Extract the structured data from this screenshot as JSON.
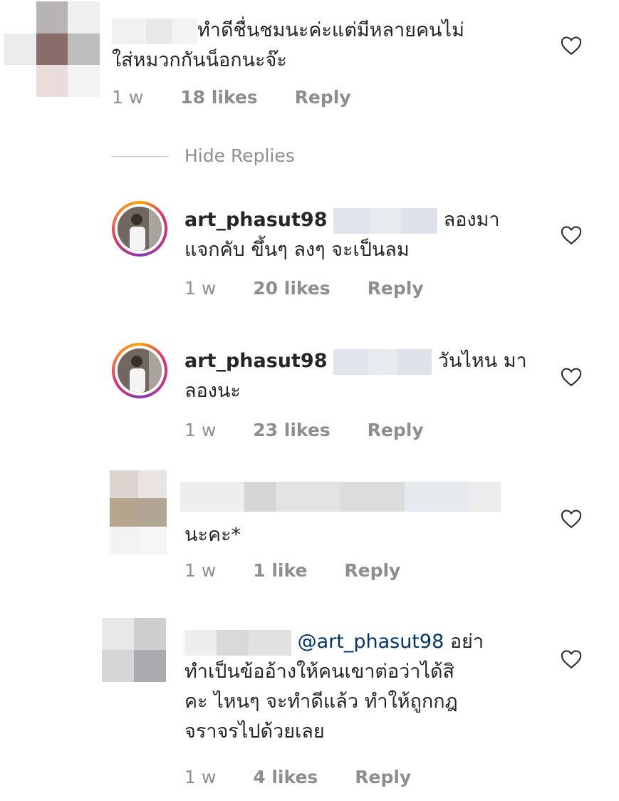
{
  "comments": [
    {
      "text_line1": "ทำดีชื่นชมนะค่ะแต่มีหลายคนไม่",
      "text_line2": "ใส่หมวกกันน็อกนะจ๊ะ",
      "time": "1 w",
      "likes": "18 likes",
      "reply": "Reply"
    },
    {
      "username": "art_phasut98",
      "text_line1": "ลองมา",
      "text_line2": "แจกคับ ขึ้นๆ ลงๆ จะเป็นลม",
      "time": "1 w",
      "likes": "20 likes",
      "reply": "Reply"
    },
    {
      "username": "art_phasut98",
      "text_line1": "วันไหน มา",
      "text_line2": "ลองนะ",
      "time": "1 w",
      "likes": "23 likes",
      "reply": "Reply"
    },
    {
      "text_line2": "นะคะ*",
      "time": "1 w",
      "likes": "1 like",
      "reply": "Reply"
    },
    {
      "mention": "@art_phasut98",
      "text_line1": "อย่า",
      "text_line2": "ทำเป็นข้ออ้างให้คนเขาต่อว่าได้สิ",
      "text_line3": "คะ ไหนๆ จะทำดีแล้ว ทำให้ถูกกฎ",
      "text_line4": "จราจรไปด้วยเลย",
      "time": "1 w",
      "likes": "4 likes",
      "reply": "Reply"
    }
  ],
  "hide_replies": "Hide Replies",
  "colors": {
    "text": "#262626",
    "meta": "#8e8e8e",
    "mention": "#003569"
  },
  "icons": {
    "like": "heart-outline-icon"
  }
}
